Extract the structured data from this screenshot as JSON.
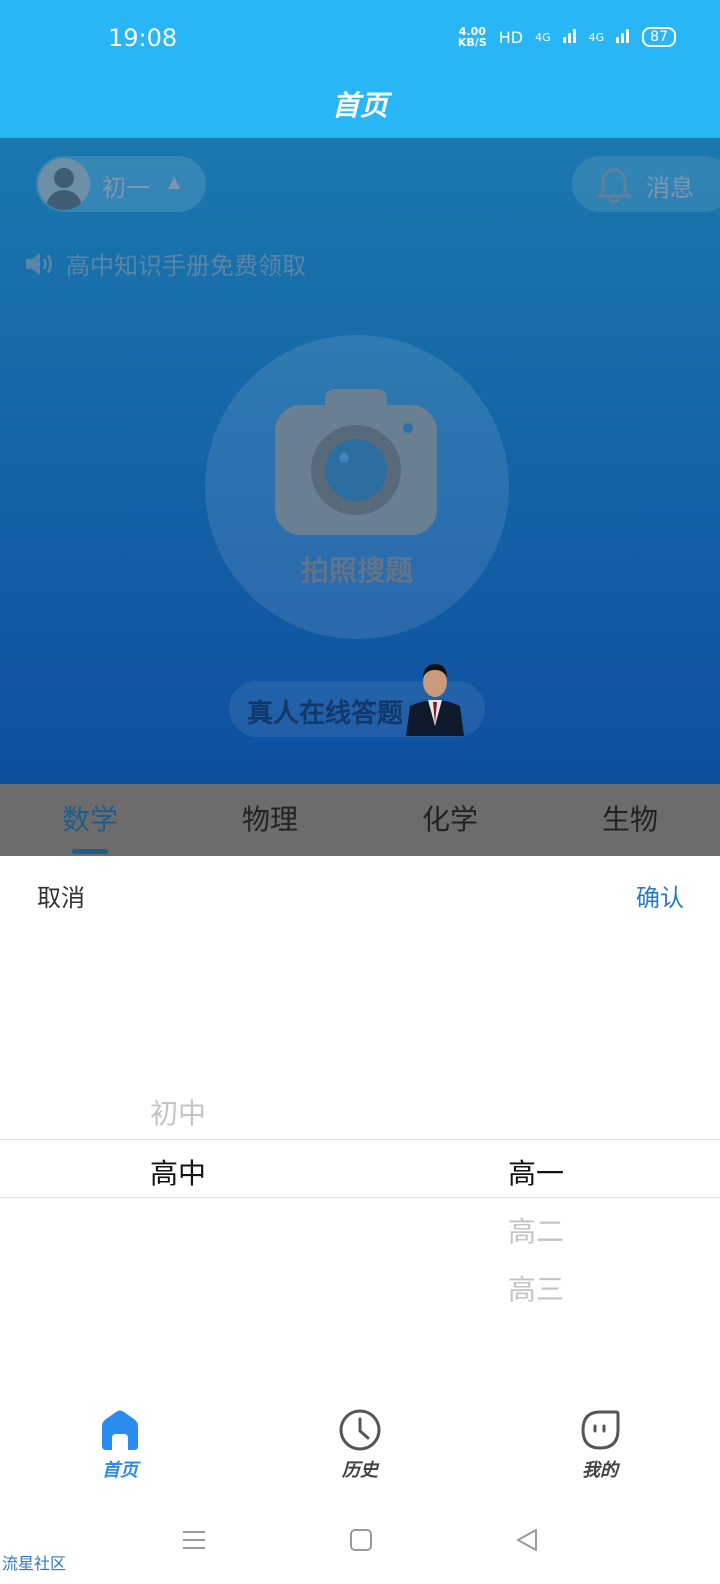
{
  "status_bar": {
    "time": "19:08",
    "net_speed_value": "4.00",
    "net_speed_unit": "KB/S",
    "hd": "HD",
    "signal1": "4G",
    "signal2": "4G",
    "battery": "87"
  },
  "header": {
    "title": "首页"
  },
  "hero": {
    "grade_label": "初一",
    "messages_label": "消息",
    "notice_text": "高中知识手册免费领取",
    "camera_label": "拍照搜题",
    "live_label": "真人在线答题"
  },
  "tabs": [
    {
      "label": "数学",
      "active": true
    },
    {
      "label": "物理",
      "active": false
    },
    {
      "label": "化学",
      "active": false
    },
    {
      "label": "生物",
      "active": false
    }
  ],
  "picker": {
    "cancel_label": "取消",
    "confirm_label": "确认",
    "level_options": [
      "初中",
      "高中"
    ],
    "level_selected": "高中",
    "grade_options": [
      "高一",
      "高二",
      "高三"
    ],
    "grade_selected": "高一"
  },
  "bottom_nav": [
    {
      "label": "首页",
      "icon": "home-icon",
      "active": true
    },
    {
      "label": "历史",
      "icon": "clock-icon",
      "active": false
    },
    {
      "label": "我的",
      "icon": "profile-icon",
      "active": false
    }
  ],
  "watermark": "流星社区",
  "colors": {
    "accent": "#29b6f6",
    "nav_active": "#2b8cf0",
    "confirm": "#2b79c8"
  }
}
